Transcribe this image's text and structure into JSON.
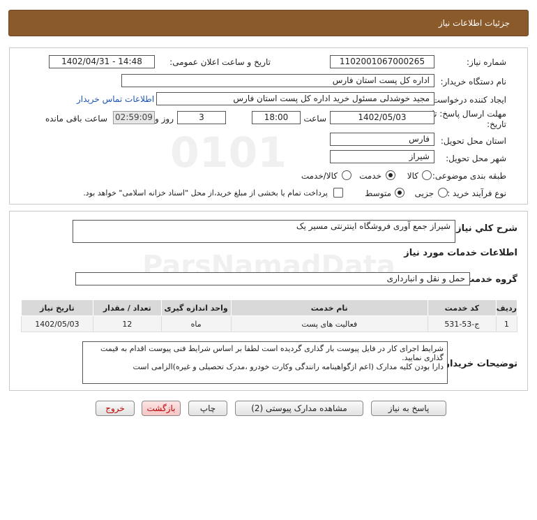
{
  "header": {
    "title": "جزئیات اطلاعات نیاز"
  },
  "info": {
    "need_number_label": "شماره نیاز:",
    "need_number": "1102001067000265",
    "announce_label": "تاریخ و ساعت اعلان عمومی:",
    "announce_value": "1402/04/31 - 14:48",
    "buyer_org_label": "نام دستگاه خریدار:",
    "buyer_org": "اداره کل پست استان فارس",
    "creator_label": "ایجاد کننده درخواست:",
    "creator": "مجید خوشدلی مسئول خرید اداره کل پست استان فارس",
    "contact_link": "اطلاعات تماس خریدار",
    "deadline_label_1": "مهلت ارسال پاسخ: تا",
    "deadline_label_2": "تاریخ:",
    "deadline_date": "1402/05/03",
    "time_label": "ساعت",
    "deadline_time": "18:00",
    "days_value": "3",
    "days_label": "روز و",
    "remaining_time": "02:59:09",
    "remaining_label": "ساعت باقی مانده",
    "province_label": "استان محل تحویل:",
    "province": "فارس",
    "city_label": "شهر محل تحویل:",
    "city": "شیراز",
    "category_label": "طبقه بندی موضوعی:",
    "category_options": [
      "کالا",
      "خدمت",
      "کالا/خدمت"
    ],
    "category_selected": "خدمت",
    "process_label": "نوع فرآیند خرید :",
    "process_options": [
      "جزیی",
      "متوسط"
    ],
    "process_selected": "متوسط",
    "payment_note": "پرداخت تمام یا بخشی از مبلغ خرید،از محل \"اسناد خزانه اسلامی\" خواهد بود."
  },
  "need": {
    "summary_label": "شرح کلي نیاز:",
    "summary": "شیراز جمع آوری فروشگاه اینترنتی مسیر یک",
    "services_title": "اطلاعات خدمات مورد نیاز",
    "group_label": "گروه خدمت:",
    "group_value": "حمل و نقل و انبارداری",
    "table_headers": [
      "ردیف",
      "کد خدمت",
      "نام خدمت",
      "واحد اندازه گیری",
      "تعداد / مقدار",
      "تاریخ نیاز"
    ],
    "rows": [
      [
        "1",
        "ج-53-531",
        "فعالیت های پست",
        "ماه",
        "12",
        "1402/05/03"
      ]
    ],
    "buyer_notes_label": "توضیحات خریدار:",
    "buyer_notes": "شرایط اجرای کار در فایل پیوست بار گذاری گردیده است لطفا بر اساس شرایط فنی پیوست اقدام به قیمت گذاری نمایید.\nدارا بودن کلیه مدارک (اعم ازگواهینامه رانندگی وکارت خودرو ،مدرک تحصیلی و غیره)الزامی است"
  },
  "buttons": {
    "reply": "پاسخ به نیاز",
    "attachments": "مشاهده مدارک پیوستی (2)",
    "print": "چاپ",
    "back": "بازگشت",
    "exit": "خروج"
  },
  "colors": {
    "header_bg": "#8b5a2b",
    "link": "#1d55b7",
    "table_header_bg": "#d9d9d9"
  }
}
